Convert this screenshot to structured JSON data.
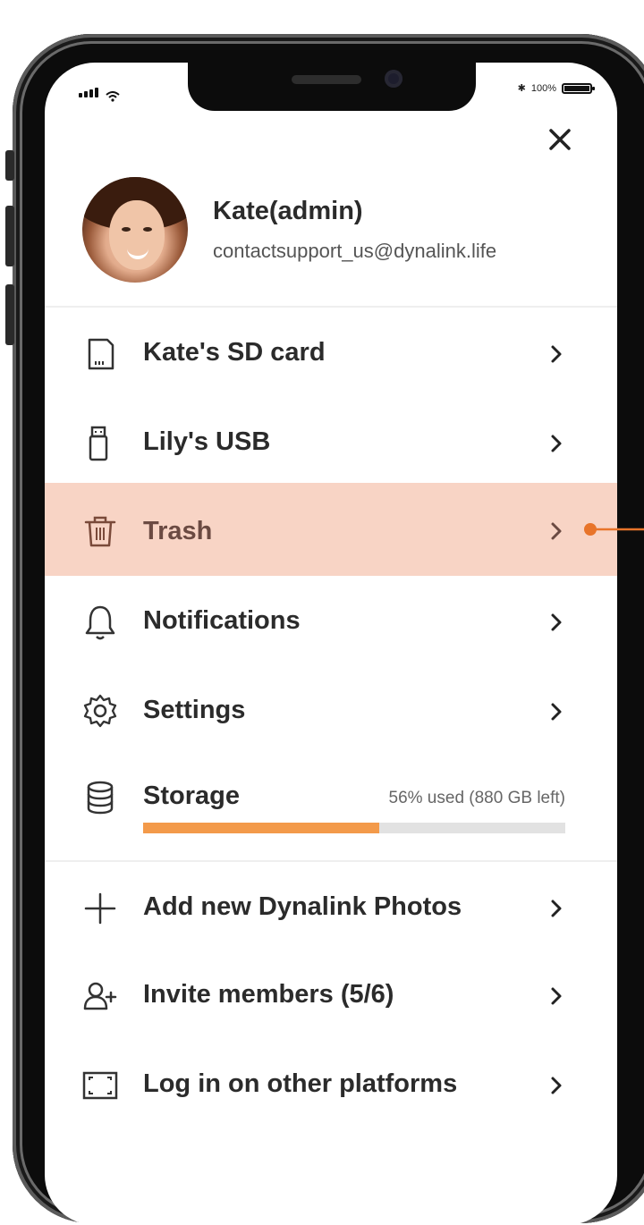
{
  "status_bar": {
    "battery_text": "100%"
  },
  "profile": {
    "name": "Kate(admin)",
    "email": "contactsupport_us@dynalink.life"
  },
  "menu": {
    "items": [
      {
        "label": "Kate's SD card",
        "icon": "sd-card-icon"
      },
      {
        "label": "Lily's USB",
        "icon": "usb-icon"
      },
      {
        "label": "Trash",
        "icon": "trash-icon",
        "highlighted": true
      },
      {
        "label": "Notifications",
        "icon": "bell-icon"
      },
      {
        "label": "Settings",
        "icon": "gear-icon"
      }
    ]
  },
  "storage": {
    "label": "Storage",
    "usage_text": "56% used (880 GB left)",
    "used_percent": 56
  },
  "actions": {
    "items": [
      {
        "label": "Add new Dynalink Photos",
        "icon": "plus-icon"
      },
      {
        "label": "Invite members (5/6)",
        "icon": "add-user-icon"
      },
      {
        "label": "Log in on other platforms",
        "icon": "scan-icon"
      }
    ]
  },
  "colors": {
    "highlight": "#f8d4c5",
    "accent": "#f39a4a",
    "callout": "#e8742a"
  }
}
